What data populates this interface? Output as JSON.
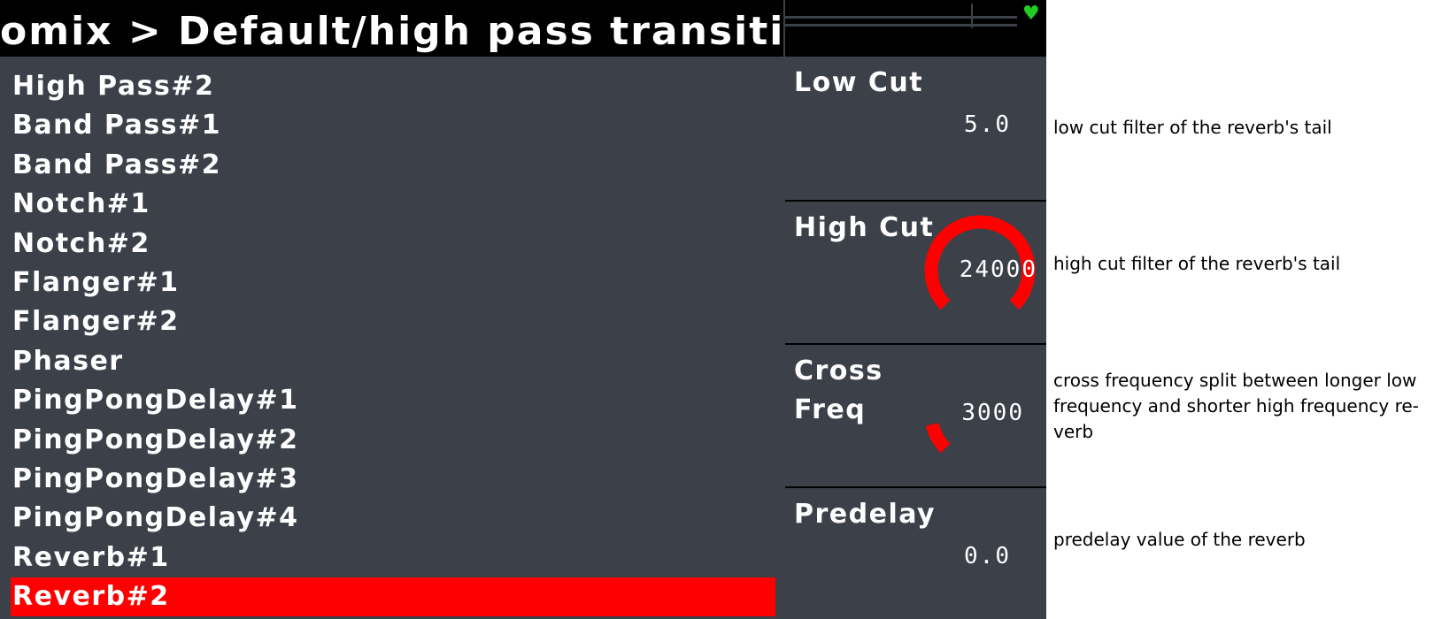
{
  "header": {
    "title": "omix > Default/high pass transiti",
    "status_icon": "heart-icon",
    "status_color": "#22cc22"
  },
  "colors": {
    "panel_bg": "#3b4049",
    "selected_bg": "#ff0000",
    "knob": "#ff0000"
  },
  "effects_list": [
    "High Pass#2",
    "Band Pass#1",
    "Band Pass#2",
    "Notch#1",
    "Notch#2",
    "Flanger#1",
    "Flanger#2",
    "Phaser",
    "PingPongDelay#1",
    "PingPongDelay#2",
    "PingPongDelay#3",
    "PingPongDelay#4",
    "Reverb#1",
    "Reverb#2"
  ],
  "selected_effect": "Reverb#2",
  "parameters": [
    {
      "label": "Low Cut",
      "value": "5.0",
      "level": 0.0
    },
    {
      "label": "High Cut",
      "value": "24000",
      "level": 1.0
    },
    {
      "label": "Cross Freq",
      "value": "3000",
      "level": 0.12
    },
    {
      "label": "Predelay",
      "value": "0.0",
      "level": 0.0
    }
  ],
  "notes": [
    "low cut filter of the reverb's tail",
    "high cut filter of the reverb's tail",
    "cross frequency split between longer low frequency and shorter high frequency re-verb",
    "predelay value of the reverb"
  ]
}
